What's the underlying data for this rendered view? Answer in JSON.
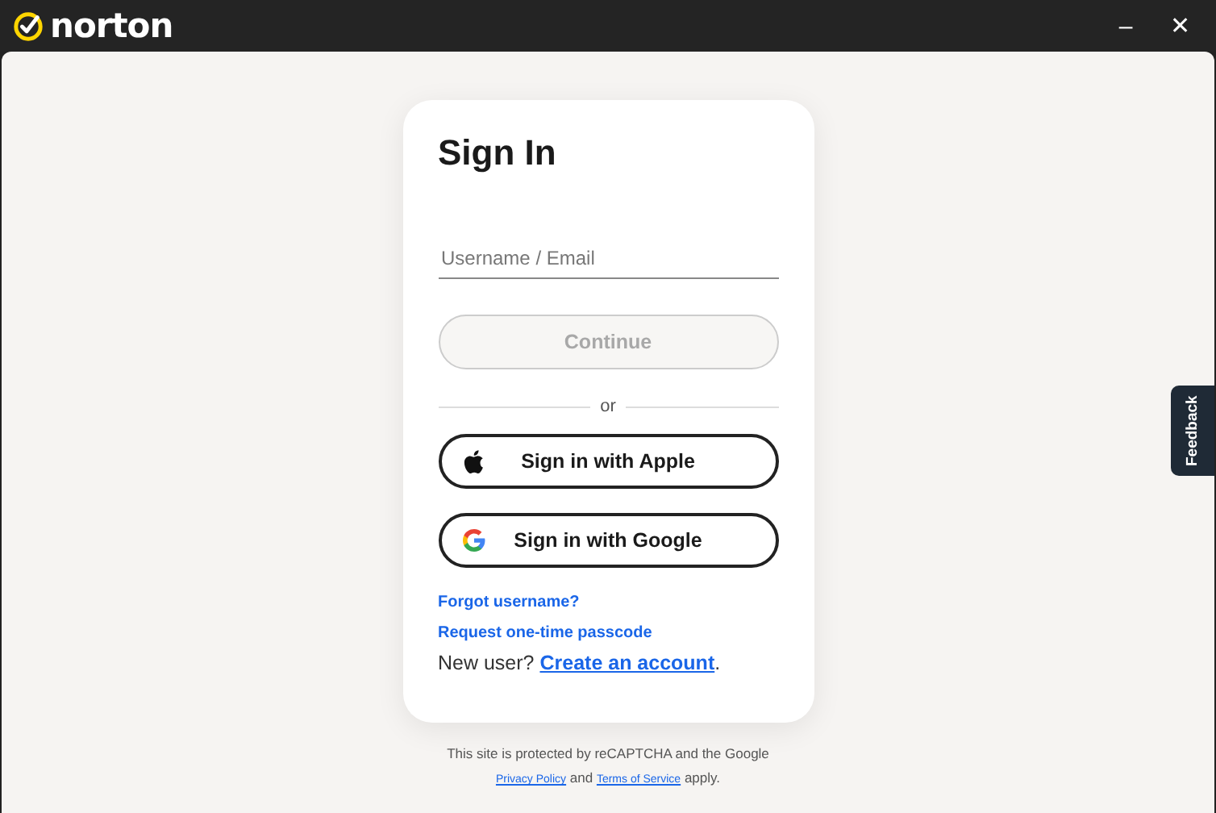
{
  "window": {
    "brand": "norton",
    "minimize": "–",
    "close": "✕"
  },
  "signin": {
    "title": "Sign In",
    "username": {
      "placeholder": "Username / Email"
    },
    "continue": {
      "label": "Continue",
      "disabled": true
    },
    "divider": "or",
    "providers": [
      {
        "kind": "apple",
        "label": "Sign in with Apple"
      },
      {
        "kind": "google",
        "label": "Sign in with Google"
      }
    ],
    "links": [
      "Forgot username?",
      "Request one-time passcode"
    ],
    "new_user": {
      "prefix": "New user?",
      "link": "Create an account",
      "suffix": "."
    }
  },
  "recaptcha": {
    "line": "This site is protected by reCAPTCHA and the Google",
    "privacy": "Privacy Policy",
    "and": "and",
    "terms": "Terms of Service",
    "suffix": "apply."
  },
  "feedback": "Feedback"
}
